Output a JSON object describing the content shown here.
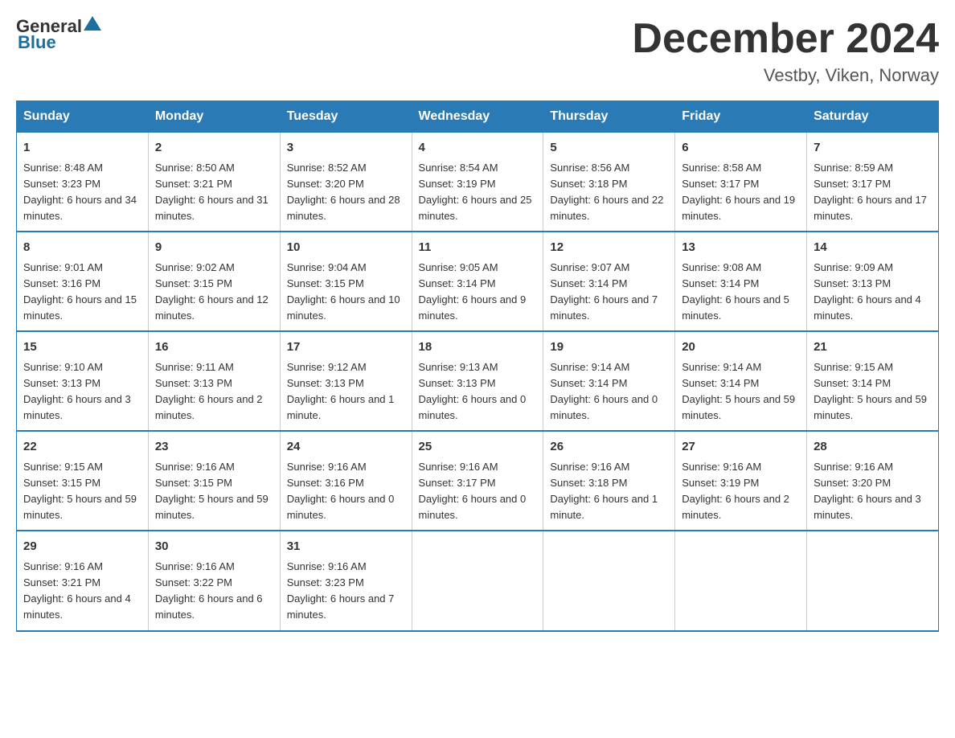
{
  "header": {
    "logo_general": "General",
    "logo_blue": "Blue",
    "month_title": "December 2024",
    "location": "Vestby, Viken, Norway"
  },
  "weekdays": [
    "Sunday",
    "Monday",
    "Tuesday",
    "Wednesday",
    "Thursday",
    "Friday",
    "Saturday"
  ],
  "weeks": [
    [
      {
        "day": "1",
        "sunrise": "8:48 AM",
        "sunset": "3:23 PM",
        "daylight": "6 hours and 34 minutes."
      },
      {
        "day": "2",
        "sunrise": "8:50 AM",
        "sunset": "3:21 PM",
        "daylight": "6 hours and 31 minutes."
      },
      {
        "day": "3",
        "sunrise": "8:52 AM",
        "sunset": "3:20 PM",
        "daylight": "6 hours and 28 minutes."
      },
      {
        "day": "4",
        "sunrise": "8:54 AM",
        "sunset": "3:19 PM",
        "daylight": "6 hours and 25 minutes."
      },
      {
        "day": "5",
        "sunrise": "8:56 AM",
        "sunset": "3:18 PM",
        "daylight": "6 hours and 22 minutes."
      },
      {
        "day": "6",
        "sunrise": "8:58 AM",
        "sunset": "3:17 PM",
        "daylight": "6 hours and 19 minutes."
      },
      {
        "day": "7",
        "sunrise": "8:59 AM",
        "sunset": "3:17 PM",
        "daylight": "6 hours and 17 minutes."
      }
    ],
    [
      {
        "day": "8",
        "sunrise": "9:01 AM",
        "sunset": "3:16 PM",
        "daylight": "6 hours and 15 minutes."
      },
      {
        "day": "9",
        "sunrise": "9:02 AM",
        "sunset": "3:15 PM",
        "daylight": "6 hours and 12 minutes."
      },
      {
        "day": "10",
        "sunrise": "9:04 AM",
        "sunset": "3:15 PM",
        "daylight": "6 hours and 10 minutes."
      },
      {
        "day": "11",
        "sunrise": "9:05 AM",
        "sunset": "3:14 PM",
        "daylight": "6 hours and 9 minutes."
      },
      {
        "day": "12",
        "sunrise": "9:07 AM",
        "sunset": "3:14 PM",
        "daylight": "6 hours and 7 minutes."
      },
      {
        "day": "13",
        "sunrise": "9:08 AM",
        "sunset": "3:14 PM",
        "daylight": "6 hours and 5 minutes."
      },
      {
        "day": "14",
        "sunrise": "9:09 AM",
        "sunset": "3:13 PM",
        "daylight": "6 hours and 4 minutes."
      }
    ],
    [
      {
        "day": "15",
        "sunrise": "9:10 AM",
        "sunset": "3:13 PM",
        "daylight": "6 hours and 3 minutes."
      },
      {
        "day": "16",
        "sunrise": "9:11 AM",
        "sunset": "3:13 PM",
        "daylight": "6 hours and 2 minutes."
      },
      {
        "day": "17",
        "sunrise": "9:12 AM",
        "sunset": "3:13 PM",
        "daylight": "6 hours and 1 minute."
      },
      {
        "day": "18",
        "sunrise": "9:13 AM",
        "sunset": "3:13 PM",
        "daylight": "6 hours and 0 minutes."
      },
      {
        "day": "19",
        "sunrise": "9:14 AM",
        "sunset": "3:14 PM",
        "daylight": "6 hours and 0 minutes."
      },
      {
        "day": "20",
        "sunrise": "9:14 AM",
        "sunset": "3:14 PM",
        "daylight": "5 hours and 59 minutes."
      },
      {
        "day": "21",
        "sunrise": "9:15 AM",
        "sunset": "3:14 PM",
        "daylight": "5 hours and 59 minutes."
      }
    ],
    [
      {
        "day": "22",
        "sunrise": "9:15 AM",
        "sunset": "3:15 PM",
        "daylight": "5 hours and 59 minutes."
      },
      {
        "day": "23",
        "sunrise": "9:16 AM",
        "sunset": "3:15 PM",
        "daylight": "5 hours and 59 minutes."
      },
      {
        "day": "24",
        "sunrise": "9:16 AM",
        "sunset": "3:16 PM",
        "daylight": "6 hours and 0 minutes."
      },
      {
        "day": "25",
        "sunrise": "9:16 AM",
        "sunset": "3:17 PM",
        "daylight": "6 hours and 0 minutes."
      },
      {
        "day": "26",
        "sunrise": "9:16 AM",
        "sunset": "3:18 PM",
        "daylight": "6 hours and 1 minute."
      },
      {
        "day": "27",
        "sunrise": "9:16 AM",
        "sunset": "3:19 PM",
        "daylight": "6 hours and 2 minutes."
      },
      {
        "day": "28",
        "sunrise": "9:16 AM",
        "sunset": "3:20 PM",
        "daylight": "6 hours and 3 minutes."
      }
    ],
    [
      {
        "day": "29",
        "sunrise": "9:16 AM",
        "sunset": "3:21 PM",
        "daylight": "6 hours and 4 minutes."
      },
      {
        "day": "30",
        "sunrise": "9:16 AM",
        "sunset": "3:22 PM",
        "daylight": "6 hours and 6 minutes."
      },
      {
        "day": "31",
        "sunrise": "9:16 AM",
        "sunset": "3:23 PM",
        "daylight": "6 hours and 7 minutes."
      },
      null,
      null,
      null,
      null
    ]
  ]
}
